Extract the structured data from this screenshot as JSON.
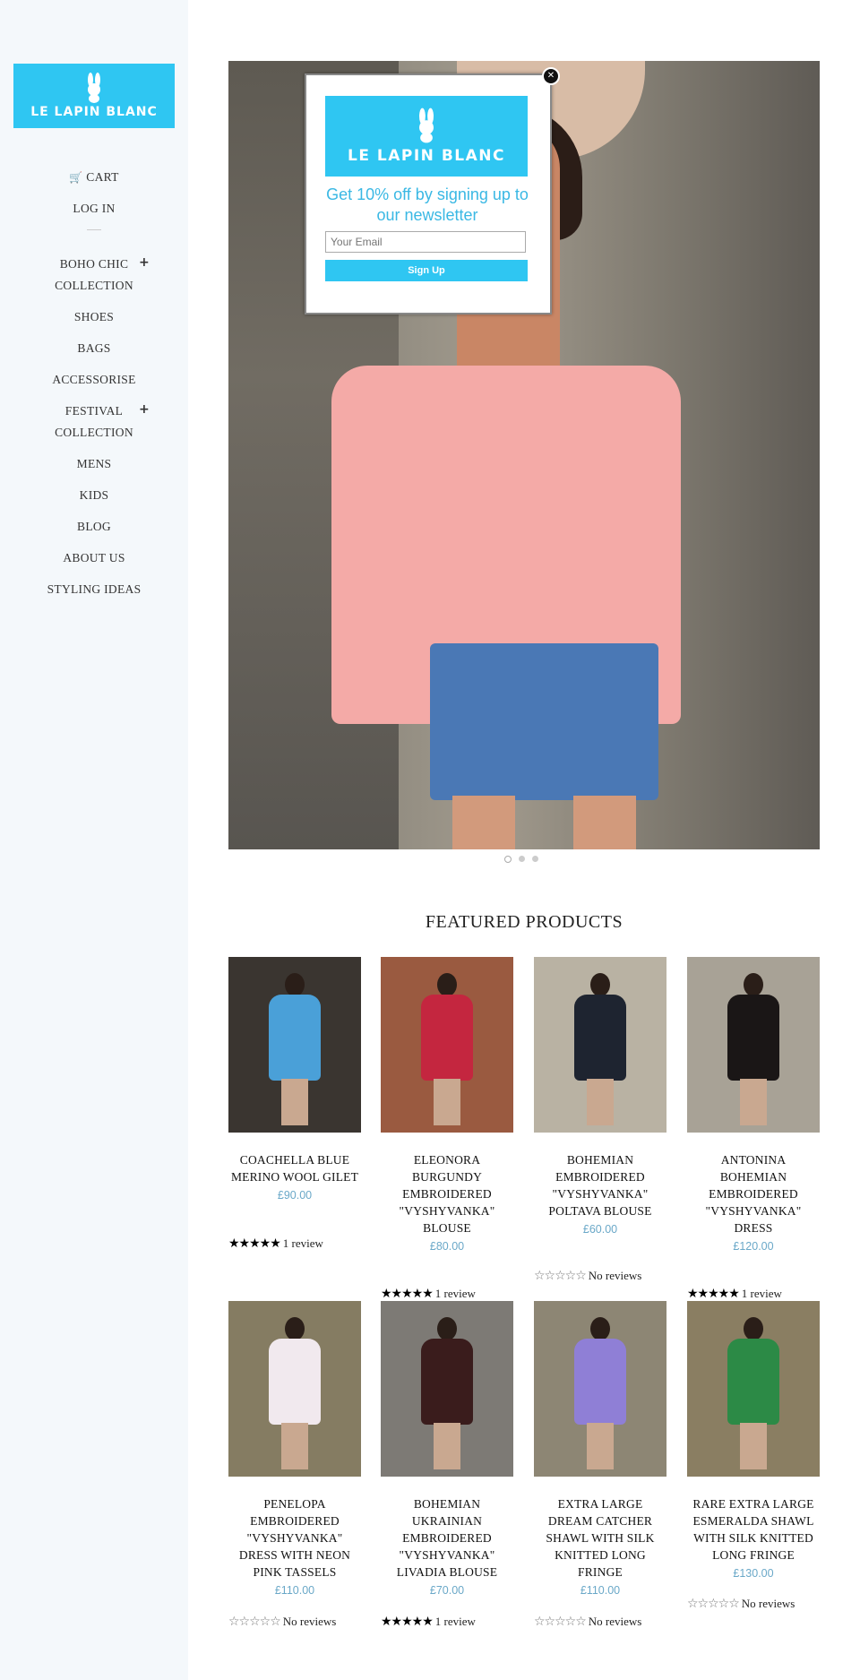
{
  "brand": {
    "name": "LE LAPIN BLANC",
    "color": "#2fc6f2"
  },
  "nav": {
    "cart_icon": "cart-icon",
    "cart": "CART",
    "login": "LOG IN",
    "items": [
      {
        "label": "BOHO CHIC COLLECTION",
        "expandable": true
      },
      {
        "label": "SHOES",
        "expandable": false
      },
      {
        "label": "BAGS",
        "expandable": false
      },
      {
        "label": "ACCESSORISE",
        "expandable": false
      },
      {
        "label": "FESTIVAL COLLECTION",
        "expandable": true
      },
      {
        "label": "MENS",
        "expandable": false
      },
      {
        "label": "KIDS",
        "expandable": false
      },
      {
        "label": "BLOG",
        "expandable": false
      },
      {
        "label": "ABOUT US",
        "expandable": false
      },
      {
        "label": "STYLING IDEAS",
        "expandable": false
      }
    ],
    "expand_symbol": "+"
  },
  "slideshow": {
    "slide_count": 3,
    "active_index": 0
  },
  "popup": {
    "close_symbol": "✕",
    "brand": "LE LAPIN BLANC",
    "headline": "Get 10% off by signing up to our newsletter",
    "email_placeholder": "Your Email",
    "signup_label": "Sign Up"
  },
  "featured": {
    "heading": "FEATURED PRODUCTS",
    "products": [
      {
        "title": "COACHELLA BLUE MERINO WOOL GILET",
        "price": "£90.00",
        "rating": 5,
        "reviews": "1 review",
        "img": "#3a3530",
        "fig": "#4aa0d8"
      },
      {
        "title": "ELEONORA BURGUNDY EMBROIDERED \"VYSHYVANKA\" BLOUSE",
        "price": "£80.00",
        "rating": 5,
        "reviews": "1 review",
        "img": "#9a5a40",
        "fig": "#c4263f"
      },
      {
        "title": "BOHEMIAN EMBROIDERED \"VYSHYVANKA\" POLTAVA BLOUSE",
        "price": "£60.00",
        "rating": 0,
        "reviews": "No reviews",
        "img": "#b9b2a3",
        "fig": "#1e2430"
      },
      {
        "title": "ANTONINA BOHEMIAN EMBROIDERED \"VYSHYVANKA\" DRESS",
        "price": "£120.00",
        "rating": 5,
        "reviews": "1 review",
        "img": "#a8a296",
        "fig": "#1a1616"
      },
      {
        "title": "PENELOPA EMBROIDERED \"VYSHYVANKA\" DRESS WITH NEON PINK TASSELS",
        "price": "£110.00",
        "rating": 0,
        "reviews": "No reviews",
        "img": "#857c62",
        "fig": "#f1e9ee"
      },
      {
        "title": "BOHEMIAN UKRAINIAN EMBROIDERED \"VYSHYVANKA\" LIVADIA BLOUSE",
        "price": "£70.00",
        "rating": 5,
        "reviews": "1 review",
        "img": "#7d7a75",
        "fig": "#3a1c1c"
      },
      {
        "title": "EXTRA LARGE DREAM CATCHER SHAWL WITH SILK KNITTED LONG FRINGE",
        "price": "£110.00",
        "rating": 0,
        "reviews": "No reviews",
        "img": "#8d8674",
        "fig": "#8f7fd6"
      },
      {
        "title": "RARE EXTRA LARGE ESMERALDA SHAWL WITH SILK KNITTED LONG FRINGE",
        "price": "£130.00",
        "rating": 0,
        "reviews": "No reviews",
        "img": "#8a7e62",
        "fig": "#2c8a46"
      }
    ]
  }
}
